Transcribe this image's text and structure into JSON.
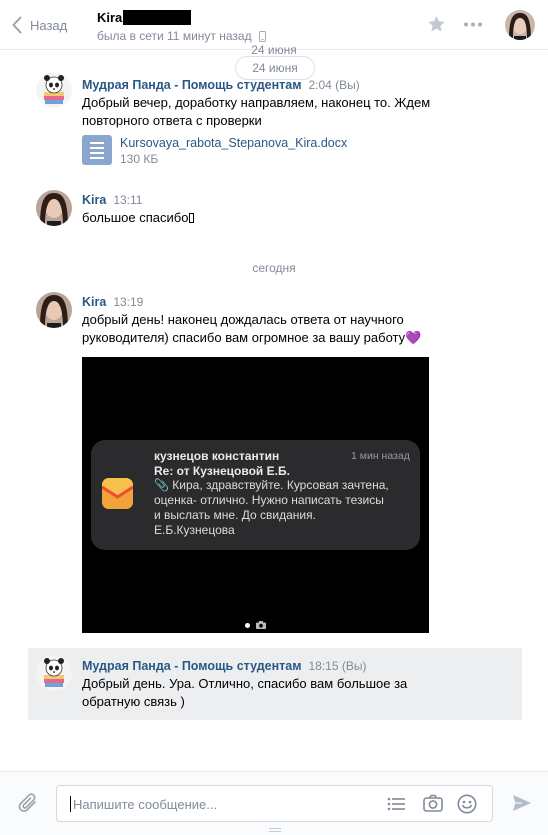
{
  "header": {
    "back_label": "Назад",
    "peer_name": "Kira",
    "peer_status": "была в сети 11 минут назад"
  },
  "dates": {
    "floating": "24 июня",
    "pill": "24 июня",
    "today": "сегодня"
  },
  "messages": [
    {
      "author": "Мудрая Панда - Помощь студентам",
      "time": "2:04 (Вы)",
      "lines": [
        "Добрый вечер, доработку направляем, наконец то. Ждем",
        "повторного ответа с проверки"
      ],
      "attachment": {
        "name": "Kursovaya_rabota_Stepanova_Kira.docx",
        "size": "130 КБ"
      }
    },
    {
      "author": "Kira",
      "time": "13:11",
      "lines": [
        "большое спасибо"
      ]
    },
    {
      "author": "Kira",
      "time": "13:19",
      "lines": [
        "добрый день! наконец дождалась ответа от научного",
        "руководителя) спасибо вам огромное за вашу работу💜"
      ],
      "photo": {
        "notif_sender": "кузнецов константин",
        "notif_time": "1 мин назад",
        "notif_subject": "Re: от Кузнецовой Е.Б.",
        "notif_lines": [
          "📎 Кира, здравствуйте. Курсовая зачтена,",
          "оценка- отлично. Нужно написать тезисы",
          "и выслать мне. До свидания.",
          "Е.Б.Кузнецова"
        ]
      }
    },
    {
      "author": "Мудрая Панда - Помощь студентам",
      "time": "18:15 (Вы)",
      "lines": [
        "Добрый день. Ура. Отлично, спасибо вам большое за",
        "обратную связь )"
      ]
    }
  ],
  "composer": {
    "placeholder": "Напишите сообщение..."
  },
  "colors": {
    "link_blue": "#2a5885",
    "muted": "#828a99",
    "selected_bg": "#edeef0"
  }
}
